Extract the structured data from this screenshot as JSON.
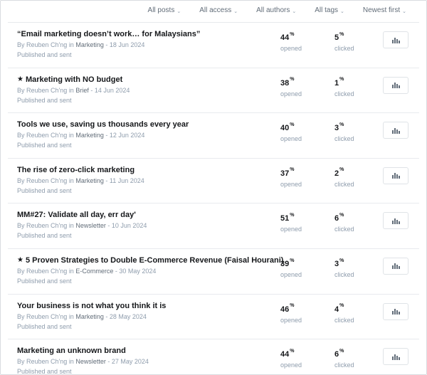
{
  "filters": [
    "All posts",
    "All access",
    "All authors",
    "All tags",
    "Newest first"
  ],
  "labels": {
    "by": "By",
    "in": "in",
    "opened": "opened",
    "clicked": "clicked",
    "percent": "%"
  },
  "posts": [
    {
      "featured": false,
      "title": "“Email marketing doesn’t work… for Malaysians”",
      "author": "Reuben Ch'ng",
      "tag": "Marketing",
      "date": "18 Jun 2024",
      "status": "Published and sent",
      "opened": "44",
      "clicked": "5"
    },
    {
      "featured": true,
      "title": "Marketing with NO budget",
      "author": "Reuben Ch'ng",
      "tag": "Brief",
      "date": "14 Jun 2024",
      "status": "Published and sent",
      "opened": "38",
      "clicked": "1"
    },
    {
      "featured": false,
      "title": "Tools we use, saving us thousands every year",
      "author": "Reuben Ch'ng",
      "tag": "Marketing",
      "date": "12 Jun 2024",
      "status": "Published and sent",
      "opened": "40",
      "clicked": "3"
    },
    {
      "featured": false,
      "title": "The rise of zero-click marketing",
      "author": "Reuben Ch'ng",
      "tag": "Marketing",
      "date": "11 Jun 2024",
      "status": "Published and sent",
      "opened": "37",
      "clicked": "2"
    },
    {
      "featured": false,
      "title": "MM#27: Validate all day, err day'",
      "author": "Reuben Ch'ng",
      "tag": "Newsletter",
      "date": "10 Jun 2024",
      "status": "Published and sent",
      "opened": "51",
      "clicked": "6"
    },
    {
      "featured": true,
      "title": "5 Proven Strategies to Double E-Commerce Revenue (Faisal Hourani)",
      "author": "Reuben Ch'ng",
      "tag": "E-Commerce",
      "date": "30 May 2024",
      "status": "Published and sent",
      "opened": "39",
      "clicked": "3"
    },
    {
      "featured": false,
      "title": "Your business is not what you think it is",
      "author": "Reuben Ch'ng",
      "tag": "Marketing",
      "date": "28 May 2024",
      "status": "Published and sent",
      "opened": "46",
      "clicked": "4"
    },
    {
      "featured": false,
      "title": "Marketing an unknown brand",
      "author": "Reuben Ch'ng",
      "tag": "Newsletter",
      "date": "27 May 2024",
      "status": "Published and sent",
      "opened": "44",
      "clicked": "6"
    }
  ],
  "icons": {
    "featured": "star-icon",
    "analytics": "bar-chart-icon",
    "dropdown": "chevron-down-icon"
  }
}
